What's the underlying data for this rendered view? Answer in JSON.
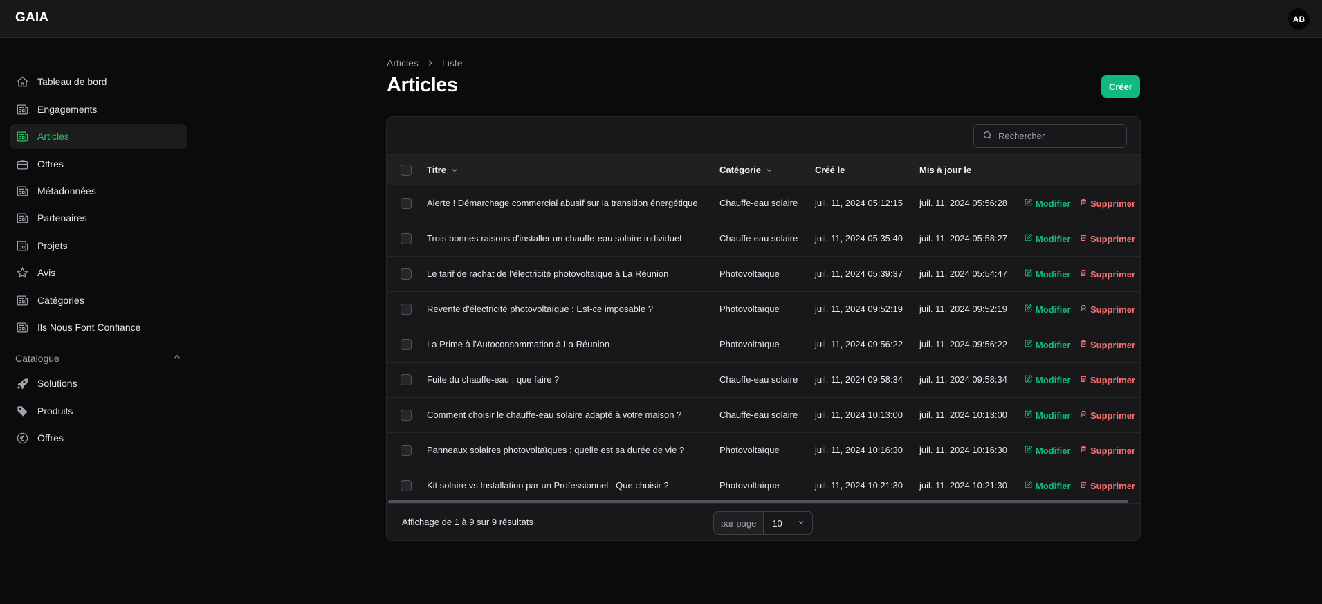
{
  "app": {
    "brand": "GAIA",
    "user_initials": "AB"
  },
  "sidebar": {
    "items": [
      {
        "label": "Tableau de bord",
        "icon": "home-icon"
      },
      {
        "label": "Engagements",
        "icon": "newspaper-icon"
      },
      {
        "label": "Articles",
        "icon": "newspaper-icon",
        "active": true
      },
      {
        "label": "Offres",
        "icon": "briefcase-icon"
      },
      {
        "label": "Métadonnées",
        "icon": "newspaper-icon"
      },
      {
        "label": "Partenaires",
        "icon": "newspaper-icon"
      },
      {
        "label": "Projets",
        "icon": "newspaper-icon"
      },
      {
        "label": "Avis",
        "icon": "star-icon"
      },
      {
        "label": "Catégories",
        "icon": "newspaper-icon"
      },
      {
        "label": "Ils Nous Font Confiance",
        "icon": "newspaper-icon"
      }
    ],
    "group": {
      "label": "Catalogue",
      "items": [
        {
          "label": "Solutions",
          "icon": "rocket-icon"
        },
        {
          "label": "Produits",
          "icon": "tag-icon"
        },
        {
          "label": "Offres",
          "icon": "euro-icon"
        }
      ]
    }
  },
  "breadcrumb": {
    "parent": "Articles",
    "current": "Liste"
  },
  "page": {
    "title": "Articles",
    "create_label": "Créer"
  },
  "search": {
    "placeholder": "Rechercher"
  },
  "table": {
    "columns": {
      "title": "Titre",
      "category": "Catégorie",
      "created": "Créé le",
      "updated": "Mis à jour le"
    },
    "edit_label": "Modifier",
    "delete_label": "Supprimer",
    "rows": [
      {
        "title": "Alerte ! Démarchage commercial abusif sur la transition énergétique",
        "category": "Chauffe-eau solaire",
        "created": "juil. 11, 2024 05:12:15",
        "updated": "juil. 11, 2024 05:56:28"
      },
      {
        "title": "Trois bonnes raisons d'installer un chauffe-eau solaire individuel",
        "category": "Chauffe-eau solaire",
        "created": "juil. 11, 2024 05:35:40",
        "updated": "juil. 11, 2024 05:58:27"
      },
      {
        "title": "Le tarif de rachat de l'électricité photovoltaïque à La Réunion",
        "category": "Photovoltaïque",
        "created": "juil. 11, 2024 05:39:37",
        "updated": "juil. 11, 2024 05:54:47"
      },
      {
        "title": "Revente d'électricité photovoltaïque : Est-ce imposable ?",
        "category": "Photovoltaïque",
        "created": "juil. 11, 2024 09:52:19",
        "updated": "juil. 11, 2024 09:52:19"
      },
      {
        "title": "La Prime à l'Autoconsommation à La Réunion",
        "category": "Photovoltaïque",
        "created": "juil. 11, 2024 09:56:22",
        "updated": "juil. 11, 2024 09:56:22"
      },
      {
        "title": "Fuite du chauffe-eau : que faire ?",
        "category": "Chauffe-eau solaire",
        "created": "juil. 11, 2024 09:58:34",
        "updated": "juil. 11, 2024 09:58:34"
      },
      {
        "title": "Comment choisir le chauffe-eau solaire adapté à votre maison ?",
        "category": "Chauffe-eau solaire",
        "created": "juil. 11, 2024 10:13:00",
        "updated": "juil. 11, 2024 10:13:00"
      },
      {
        "title": "Panneaux solaires photovoltaïques : quelle est sa durée de vie ?",
        "category": "Photovoltaïque",
        "created": "juil. 11, 2024 10:16:30",
        "updated": "juil. 11, 2024 10:16:30"
      },
      {
        "title": "Kit solaire vs Installation par un Professionnel : Que choisir ?",
        "category": "Photovoltaïque",
        "created": "juil. 11, 2024 10:21:30",
        "updated": "juil. 11, 2024 10:21:30"
      }
    ]
  },
  "pagination": {
    "summary": "Affichage de 1 à 9 sur 9 résultats",
    "per_page_label": "par page",
    "per_page_value": "10"
  },
  "colors": {
    "accent": "#10b981",
    "danger": "#f87171",
    "background": "#0b0b0c"
  }
}
